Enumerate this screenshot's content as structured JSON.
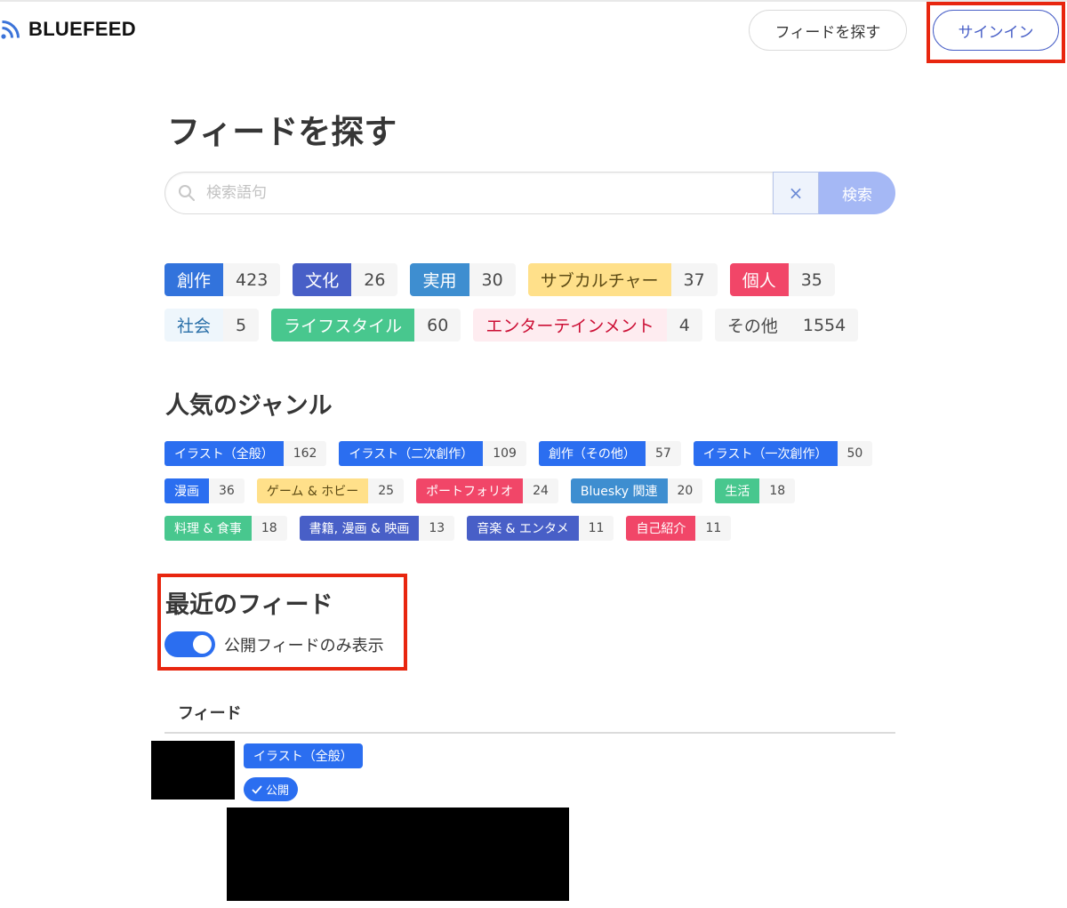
{
  "header": {
    "brand": "BLUEFEED",
    "find_button": "フィードを探す",
    "signin_button": "サインイン"
  },
  "page_title": "フィードを探す",
  "search": {
    "placeholder": "検索語句",
    "clear_label": "×",
    "submit_label": "検索"
  },
  "categories": [
    {
      "label": "創作",
      "count": "423",
      "bg": "#3273dc",
      "fg": "#ffffff"
    },
    {
      "label": "文化",
      "count": "26",
      "bg": "#485fc7",
      "fg": "#ffffff"
    },
    {
      "label": "実用",
      "count": "30",
      "bg": "#3e8ed0",
      "fg": "#ffffff"
    },
    {
      "label": "サブカルチャー",
      "count": "37",
      "bg": "#ffe08a",
      "fg": "#5c4a14"
    },
    {
      "label": "個人",
      "count": "35",
      "bg": "#f14668",
      "fg": "#ffffff"
    },
    {
      "label": "社会",
      "count": "5",
      "bg": "#eef6fc",
      "fg": "#296fa8"
    },
    {
      "label": "ライフスタイル",
      "count": "60",
      "bg": "#48c78e",
      "fg": "#ffffff"
    },
    {
      "label": "エンターテインメント",
      "count": "4",
      "bg": "#feecf0",
      "fg": "#cc0f35"
    },
    {
      "label": "その他",
      "count": "1554",
      "bg": "#f5f5f5",
      "fg": "#4a4a4a"
    }
  ],
  "genre_title": "人気のジャンル",
  "genres": [
    {
      "label": "イラスト（全般）",
      "count": "162",
      "bg": "#2b6ef0",
      "fg": "#ffffff"
    },
    {
      "label": "イラスト（二次創作）",
      "count": "109",
      "bg": "#2b6ef0",
      "fg": "#ffffff"
    },
    {
      "label": "創作（その他）",
      "count": "57",
      "bg": "#2b6ef0",
      "fg": "#ffffff"
    },
    {
      "label": "イラスト（一次創作）",
      "count": "50",
      "bg": "#2b6ef0",
      "fg": "#ffffff"
    },
    {
      "label": "漫画",
      "count": "36",
      "bg": "#2b6ef0",
      "fg": "#ffffff"
    },
    {
      "label": "ゲーム & ホビー",
      "count": "25",
      "bg": "#ffe08a",
      "fg": "#5c4a14"
    },
    {
      "label": "ポートフォリオ",
      "count": "24",
      "bg": "#f14668",
      "fg": "#ffffff"
    },
    {
      "label": "Bluesky 関連",
      "count": "20",
      "bg": "#3e8ed0",
      "fg": "#ffffff"
    },
    {
      "label": "生活",
      "count": "18",
      "bg": "#48c78e",
      "fg": "#ffffff"
    },
    {
      "label": "料理 & 食事",
      "count": "18",
      "bg": "#48c78e",
      "fg": "#ffffff"
    },
    {
      "label": "書籍, 漫画 & 映画",
      "count": "13",
      "bg": "#485fc7",
      "fg": "#ffffff"
    },
    {
      "label": "音楽 & エンタメ",
      "count": "11",
      "bg": "#485fc7",
      "fg": "#ffffff"
    },
    {
      "label": "自己紹介",
      "count": "11",
      "bg": "#f14668",
      "fg": "#ffffff"
    }
  ],
  "recent": {
    "title": "最近のフィード",
    "toggle_label": "公開フィードのみ表示",
    "toggle_on": true,
    "table_header": "フィード",
    "rows": [
      {
        "genre_tag": "イラスト（全般）",
        "status_badge": "公開"
      }
    ]
  },
  "colors": {
    "primary": "#2b6ef0",
    "link": "#485fc7",
    "highlight_box": "#e8260f"
  }
}
